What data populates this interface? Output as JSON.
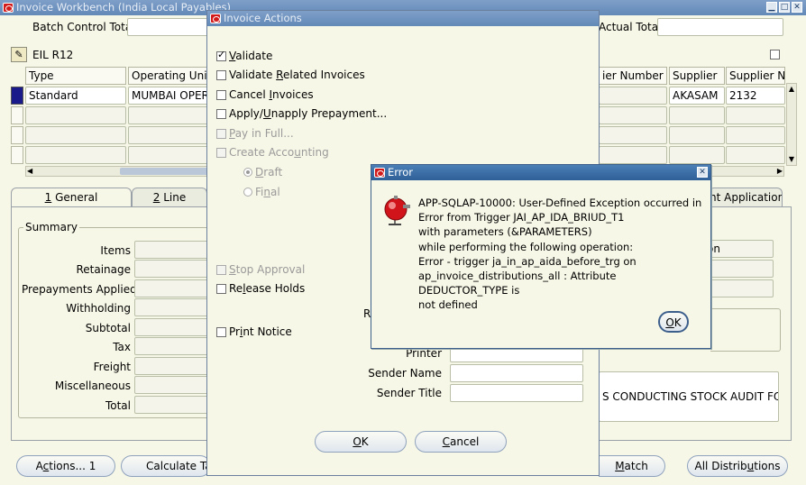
{
  "main_window": {
    "title": "Invoice Workbench (India Local Payables)",
    "batch_control_total_label": "Batch Control Total",
    "actual_total_label": "Actual Total",
    "org_name": "EIL R12",
    "columns": [
      "Type",
      "Operating Unit",
      "ier Number",
      "Supplier",
      "Supplier Nur"
    ],
    "row1": {
      "type": "Standard",
      "operating_unit": "MUMBAI OPER",
      "supplier": "AKASAM",
      "supplier_num": "2132"
    },
    "tabs": {
      "general_num": "1",
      "general": " General",
      "lines_num": "2",
      "lines": " Line",
      "applications": "nt Applications"
    },
    "summary": {
      "title": "Summary",
      "labels": [
        "Items",
        "Retainage",
        "Prepayments Applied",
        "Withholding",
        "Subtotal",
        "Tax",
        "Freight",
        "Miscellaneous",
        "Total"
      ]
    },
    "right_fragment_label": "on",
    "printer_label": "Printer",
    "sender_name_label": "Sender Name",
    "sender_title_label": "Sender Title",
    "description_fragment": "S CONDUCTING STOCK AUDIT FOR",
    "buttons": {
      "actions_pre": "A",
      "actions_u": "c",
      "actions_post": "tions... 1",
      "calculate": "Calculate Ta",
      "match_u": "M",
      "match_post": "atch",
      "all_dist_pre": "All Distrib",
      "all_dist_u": "u",
      "all_dist_post": "tions"
    }
  },
  "invoice_actions": {
    "title": "Invoice Actions",
    "options": {
      "validate_u": "V",
      "validate_post": "alidate",
      "validate_related_pre": "Validate ",
      "validate_related_u": "R",
      "validate_related_post": "elated Invoices",
      "cancel_pre": "Cancel ",
      "cancel_u": "I",
      "cancel_post": "nvoices",
      "apply_pre": "Apply/",
      "apply_u": "U",
      "apply_post": "napply Prepayment...",
      "pay_u": "P",
      "pay_post": "ay in Full...",
      "create_pre": "Create Acco",
      "create_u": "u",
      "create_post": "nting",
      "draft_u": "D",
      "draft_post": "raft",
      "final_pre": "Fi",
      "final_u": "n",
      "final_post": "al",
      "stop_u": "S",
      "stop_post": "top Approval",
      "release_pre": "Re",
      "release_u": "l",
      "release_post": "ease Holds",
      "print_pre": "Pr",
      "print_u": "i",
      "print_post": "nt Notice"
    },
    "r_fragment": "R",
    "ok_u": "O",
    "ok_post": "K",
    "cancel_btn_u": "C",
    "cancel_btn_post": "ancel"
  },
  "error_dialog": {
    "title": "Error",
    "message_lines": [
      "APP-SQLAP-10000: User-Defined Exception occurred in",
      "Error from Trigger JAI_AP_IDA_BRIUD_T1",
      "with parameters (&PARAMETERS)",
      "while performing the following operation:",
      "Error - trigger ja_in_ap_aida_before_trg on",
      "ap_invoice_distributions_all : Attribute DEDUCTOR_TYPE is",
      "not defined"
    ],
    "ok_u": "O",
    "ok_post": "K"
  }
}
